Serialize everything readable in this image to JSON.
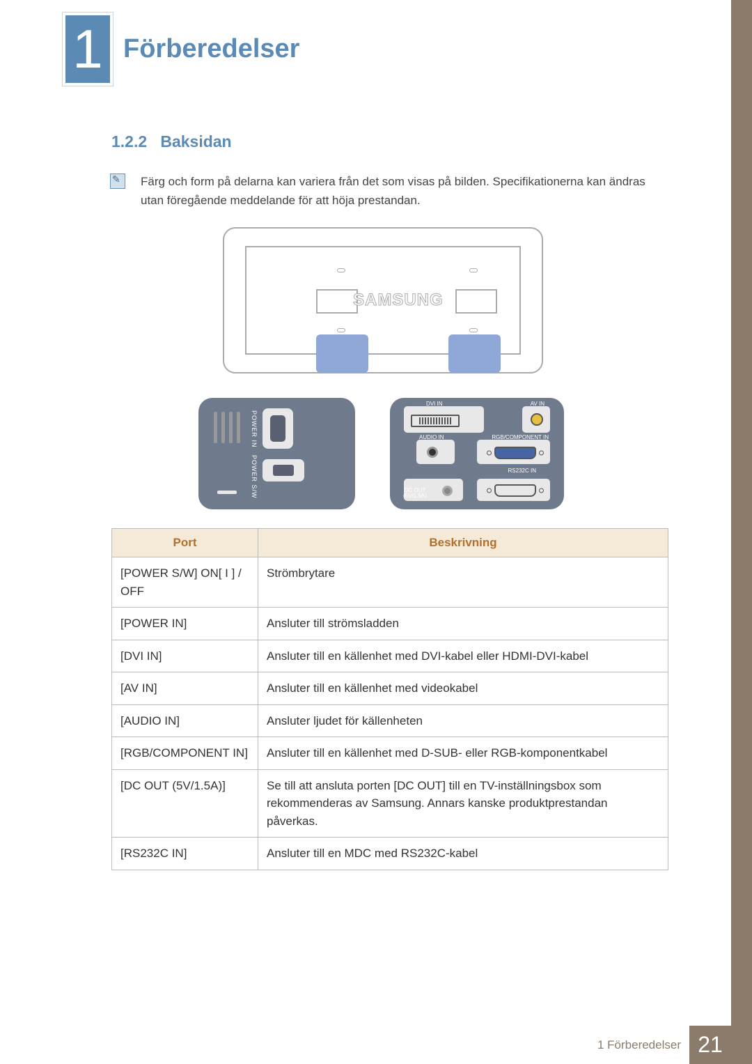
{
  "chapter": {
    "number": "1",
    "title": "Förberedelser"
  },
  "section": {
    "number": "1.2.2",
    "title": "Baksidan"
  },
  "note": "Färg och form på delarna kan variera från det som visas på bilden. Specifikationerna kan ändras utan föregående meddelande för att höja prestandan.",
  "diagram": {
    "brand": "SAMSUNG",
    "left_labels": {
      "power_in": "POWER IN",
      "power_sw": "POWER S/W"
    },
    "right_labels": {
      "dvi": "DVI IN",
      "av": "AV IN",
      "audio": "AUDIO IN",
      "rgb": "RGB/COMPONENT IN",
      "dc": "DC OUT\n(5V/1.5A)",
      "rs": "RS232C IN"
    }
  },
  "table": {
    "headers": {
      "port": "Port",
      "desc": "Beskrivning"
    },
    "rows": [
      {
        "port": "[POWER S/W] ON[ I ] / OFF",
        "desc": "Strömbrytare"
      },
      {
        "port": "[POWER IN]",
        "desc": "Ansluter till strömsladden"
      },
      {
        "port": "[DVI IN]",
        "desc": "Ansluter till en källenhet med DVI-kabel eller HDMI-DVI-kabel"
      },
      {
        "port": "[AV IN]",
        "desc": "Ansluter till en källenhet med videokabel"
      },
      {
        "port": "[AUDIO IN]",
        "desc": "Ansluter ljudet för källenheten"
      },
      {
        "port": "[RGB/COMPONENT IN]",
        "desc": "Ansluter till en källenhet med D-SUB- eller RGB-komponentkabel"
      },
      {
        "port": "[DC OUT (5V/1.5A)]",
        "desc": "Se till att ansluta porten [DC OUT] till en TV-inställningsbox som rekommenderas av Samsung. Annars kanske produktprestandan påverkas."
      },
      {
        "port": "[RS232C IN]",
        "desc": "Ansluter till en MDC med RS232C-kabel"
      }
    ]
  },
  "footer": {
    "label": "1 Förberedelser",
    "page": "21"
  }
}
